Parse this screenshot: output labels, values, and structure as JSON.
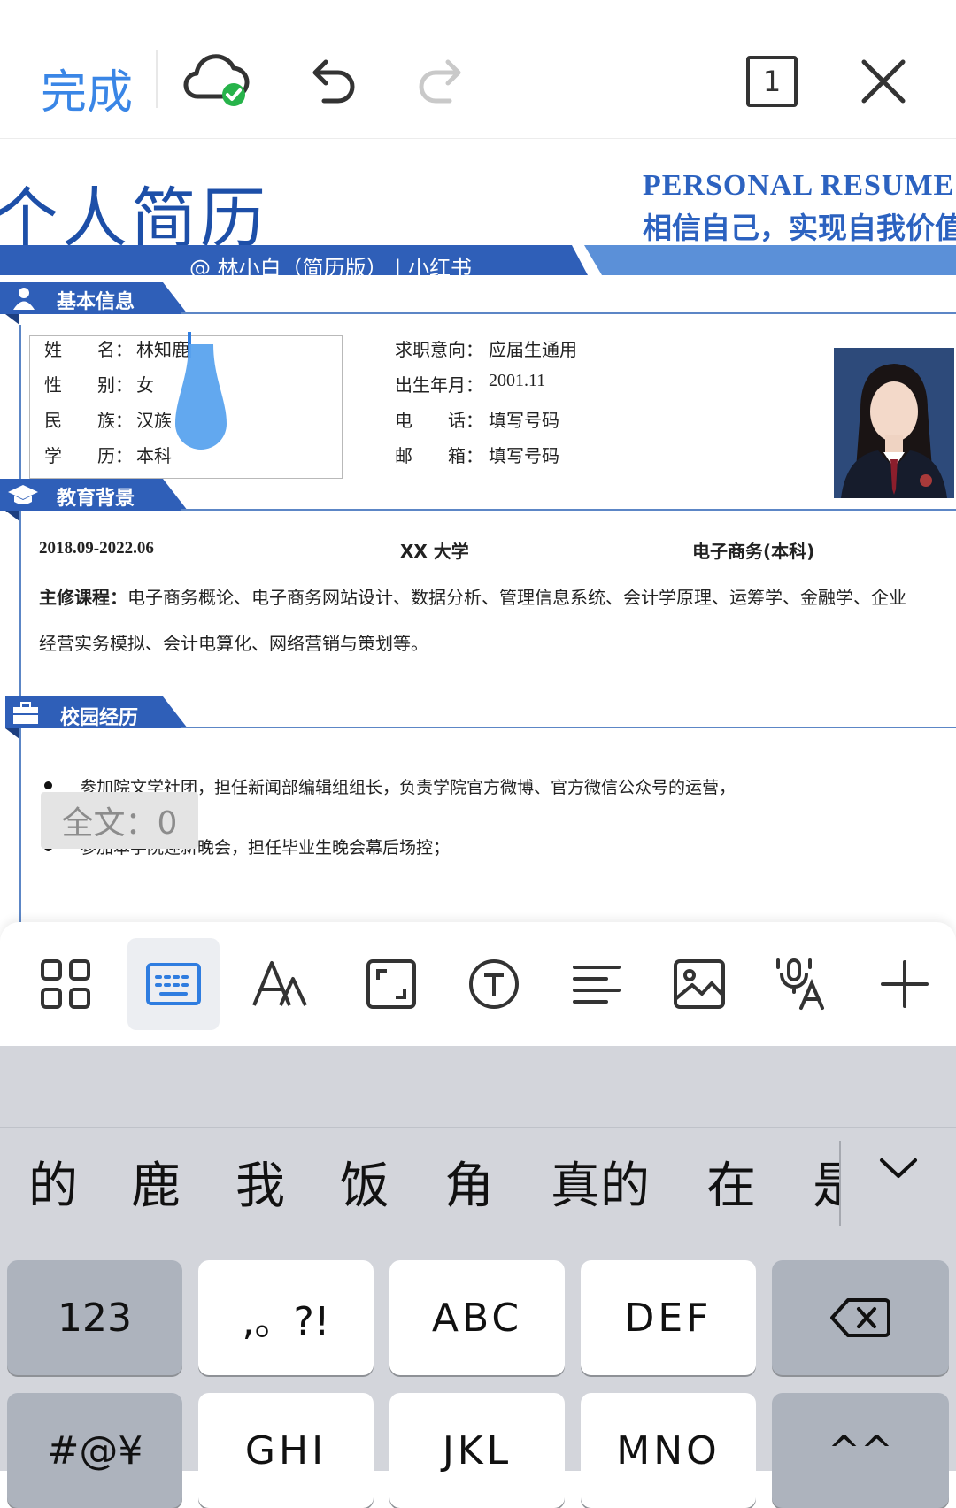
{
  "toolbar": {
    "done_label": "完成",
    "icons": [
      "cloud-check-icon",
      "undo-icon",
      "redo-icon",
      "page-count-icon",
      "close-icon"
    ],
    "page_count": "1"
  },
  "resume": {
    "title_cn": "个人简历",
    "title_en": "PERSONAL RESUME",
    "motto": "相信自己，实现自我价值",
    "banner": "@ 林小白（简历版）  |  小红书",
    "sections": {
      "basic": "基本信息",
      "education": "教育背景",
      "campus": "校园经历"
    },
    "basic_info": {
      "name_label": "姓　　名：",
      "name_value": "林知鹿",
      "gender_label": "性　　别：",
      "gender_value": "女",
      "ethnic_label": "民　　族：",
      "ethnic_value": "汉族",
      "degree_label": "学　　历：",
      "degree_value": "本科",
      "intent_label": "求职意向：",
      "intent_value": "应届生通用",
      "birth_label": "出生年月：",
      "birth_value": "2001.11",
      "phone_label": "电　　话：",
      "phone_value": "填写号码",
      "email_label": "邮　　箱：",
      "email_value": "填写号码"
    },
    "education": {
      "period": "2018.09-2022.06",
      "school": "XX  大学",
      "major": "电子商务(本科)",
      "courses_label": "主修课程：",
      "courses_line1": "电子商务概论、电子商务网站设计、数据分析、管理信息系统、会计学原理、运筹学、金融学、企业",
      "courses_line2": "经营实务模拟、会计电算化、网络营销与策划等。"
    },
    "campus": {
      "item1": "参加院文学社团，担任新闻部编辑组组长，负责学院官方微博、官方微信公众号的运营，",
      "item2": "参加本学院迎新晚会，担任毕业生晚会幕后场控；"
    }
  },
  "word_count": "全文：0",
  "format_toolbar": {
    "icons": [
      "apps-grid-icon",
      "keyboard-icon",
      "text-style-icon",
      "fullscreen-icon",
      "text-box-icon",
      "paragraph-align-icon",
      "image-icon",
      "voice-to-text-icon",
      "add-icon"
    ],
    "active": "keyboard-icon"
  },
  "keyboard": {
    "candidates": [
      "的",
      "鹿",
      "我",
      "饭",
      "角",
      "真的",
      "在",
      "是"
    ],
    "row1": [
      "123",
      ",。?!",
      "ABC",
      "DEF"
    ],
    "row2": [
      "#@¥",
      "GHI",
      "JKL",
      "MNO",
      "^^"
    ],
    "delete_icon": "backspace-icon",
    "expand_icon": "chevron-down-icon"
  },
  "colors": {
    "accent": "#3a86e6",
    "resume_blue": "#2c62c0",
    "banner_dark": "#2f5fb8",
    "banner_light": "#5b90d8"
  }
}
